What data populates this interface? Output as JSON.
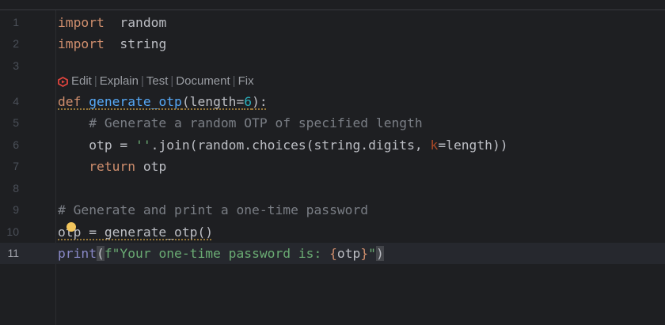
{
  "editor": {
    "inlay_actions": [
      "Edit",
      "Explain",
      "Test",
      "Document",
      "Fix"
    ],
    "inlay_before_line": 4,
    "current_line": 11,
    "lines": [
      {
        "n": "1",
        "tokens": [
          [
            "kw",
            "import"
          ],
          [
            "",
            "  random"
          ]
        ]
      },
      {
        "n": "2",
        "tokens": [
          [
            "kw",
            "import"
          ],
          [
            "",
            "  string"
          ]
        ]
      },
      {
        "n": "3",
        "tokens": []
      },
      {
        "n": "4",
        "squiggle": true,
        "tokens": [
          [
            "kw",
            "def "
          ],
          [
            "fn",
            "generate_otp"
          ],
          [
            "",
            "(length="
          ],
          [
            "num",
            "6"
          ],
          [
            "",
            "):"
          ]
        ]
      },
      {
        "n": "5",
        "tokens": [
          [
            "cm",
            "    # Generate a random OTP of specified length"
          ]
        ]
      },
      {
        "n": "6",
        "tokens": [
          [
            "",
            "    otp = "
          ],
          [
            "str",
            "''"
          ],
          [
            "",
            ".join(random.choices(string.digits, "
          ],
          [
            "named",
            "k"
          ],
          [
            "",
            "=length))"
          ]
        ]
      },
      {
        "n": "7",
        "tokens": [
          [
            "kw",
            "    return"
          ],
          [
            "",
            " otp"
          ]
        ]
      },
      {
        "n": "8",
        "tokens": []
      },
      {
        "n": "9",
        "tokens": [
          [
            "cm",
            "# Generate and print a one-time password"
          ]
        ]
      },
      {
        "n": "10",
        "squiggle": true,
        "tokens": [
          [
            "",
            "otp = generate_otp()"
          ]
        ]
      },
      {
        "n": "11",
        "tokens": [
          [
            "builtin",
            "print"
          ],
          [
            "match",
            "("
          ],
          [
            "str",
            "f\"Your one-time password is: "
          ],
          [
            "brace",
            "{"
          ],
          [
            "",
            "otp"
          ],
          [
            "brace",
            "}"
          ],
          [
            "str",
            "\""
          ],
          [
            "match",
            ")"
          ]
        ]
      }
    ]
  },
  "colors": {
    "keyword": "#cf8e6d",
    "function": "#56a8f5",
    "comment": "#7a7e85",
    "string": "#6aab73",
    "number": "#2aacb8",
    "ai_icon": "#e0443e",
    "bulb": "#f2c55c"
  }
}
